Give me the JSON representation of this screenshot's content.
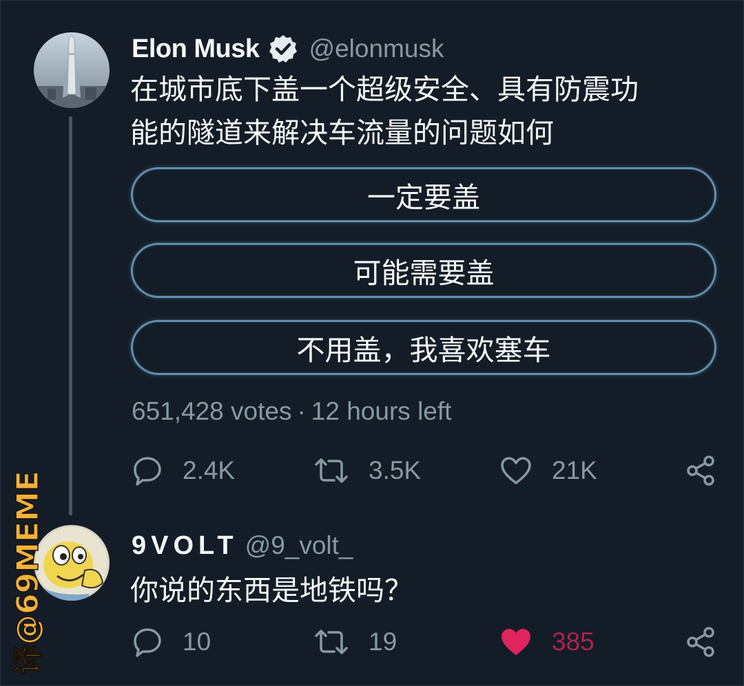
{
  "main_tweet": {
    "display_name": "Elon Musk",
    "handle": "@elonmusk",
    "text_line1": "在城市底下盖一个超级安全、具有防震功",
    "text_line2": "能的隧道来解决车流量的问题如何",
    "poll": {
      "options": [
        "一定要盖",
        "可能需要盖",
        "不用盖，我喜欢塞车"
      ],
      "votes": "651,428 votes",
      "separator": "·",
      "time_left": "12 hours left"
    },
    "actions": {
      "replies": "2.4K",
      "retweets": "3.5K",
      "likes": "21K"
    }
  },
  "reply_tweet": {
    "display_name": "9VOLT",
    "handle": "@9_volt_",
    "text": "你说的东西是地铁吗？",
    "actions": {
      "replies": "10",
      "retweets": "19",
      "likes": "385",
      "liked": true
    }
  },
  "watermark": {
    "text": "译@69MEME"
  },
  "colors": {
    "background": "#15202b",
    "poll_border": "#5f8fb0",
    "secondary_text": "#8899a6",
    "like_red": "#e0245e",
    "verified": "#e6ecf0"
  }
}
